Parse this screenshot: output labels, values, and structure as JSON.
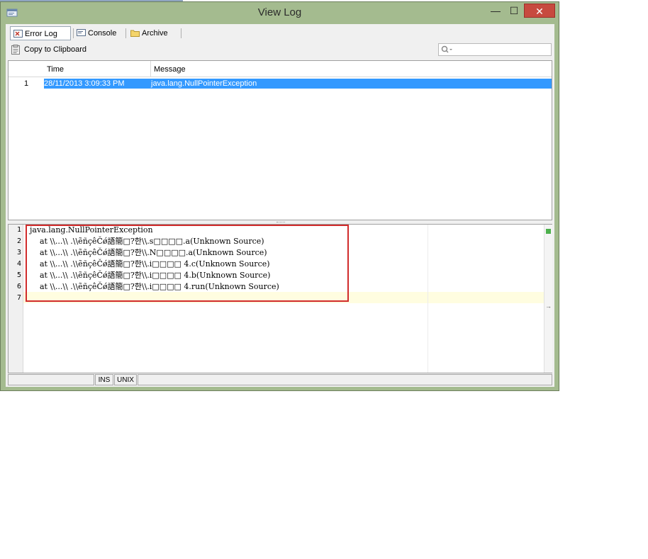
{
  "window": {
    "title": "View Log"
  },
  "title_buttons": {
    "minimize": "—",
    "maximize": "☐",
    "close": "✕"
  },
  "tabs": [
    {
      "label": "Error Log",
      "icon": "error-log-icon",
      "active": true
    },
    {
      "label": "Console",
      "icon": "console-icon",
      "active": false
    },
    {
      "label": "Archive",
      "icon": "folder-icon",
      "active": false
    }
  ],
  "toolbar": {
    "copy_label": "Copy to Clipboard",
    "search_value": ""
  },
  "grid": {
    "columns": [
      "",
      "Time",
      "Message"
    ],
    "rows": [
      {
        "num": "1",
        "time": "28/11/2013 3:09:33 PM",
        "message": "java.lang.NullPointerException"
      }
    ]
  },
  "editor": {
    "line_numbers": [
      "1",
      "2",
      "3",
      "4",
      "5",
      "6",
      "7"
    ],
    "lines": [
      "java.lang.NullPointerException",
      "    at \\\\...\\\\ .\\\\ẽñçêČǿ語簡□?한\\\\.s□□□□.a(Unknown Source)",
      "    at \\\\...\\\\ .\\\\ẽñçêČǿ語簡□?한\\\\.N□□□□.a(Unknown Source)",
      "    at \\\\...\\\\ .\\\\ẽñçêČǿ語簡□?한\\\\.i□□□□ 4.c(Unknown Source)",
      "    at \\\\...\\\\ .\\\\ẽñçêČǿ語簡□?한\\\\.i□□□□ 4.b(Unknown Source)",
      "    at \\\\...\\\\ .\\\\ẽñçêČǿ語簡□?한\\\\.i□□□□ 4.run(Unknown Source)",
      ""
    ]
  },
  "status_bar": {
    "position": "",
    "mode": "INS",
    "line_ending": "UNIX",
    "message": ""
  },
  "colors": {
    "window_frame": "#a4bb8f",
    "selection": "#3399ff",
    "close": "#c74a3f",
    "highlight_box": "#d12b2b"
  }
}
